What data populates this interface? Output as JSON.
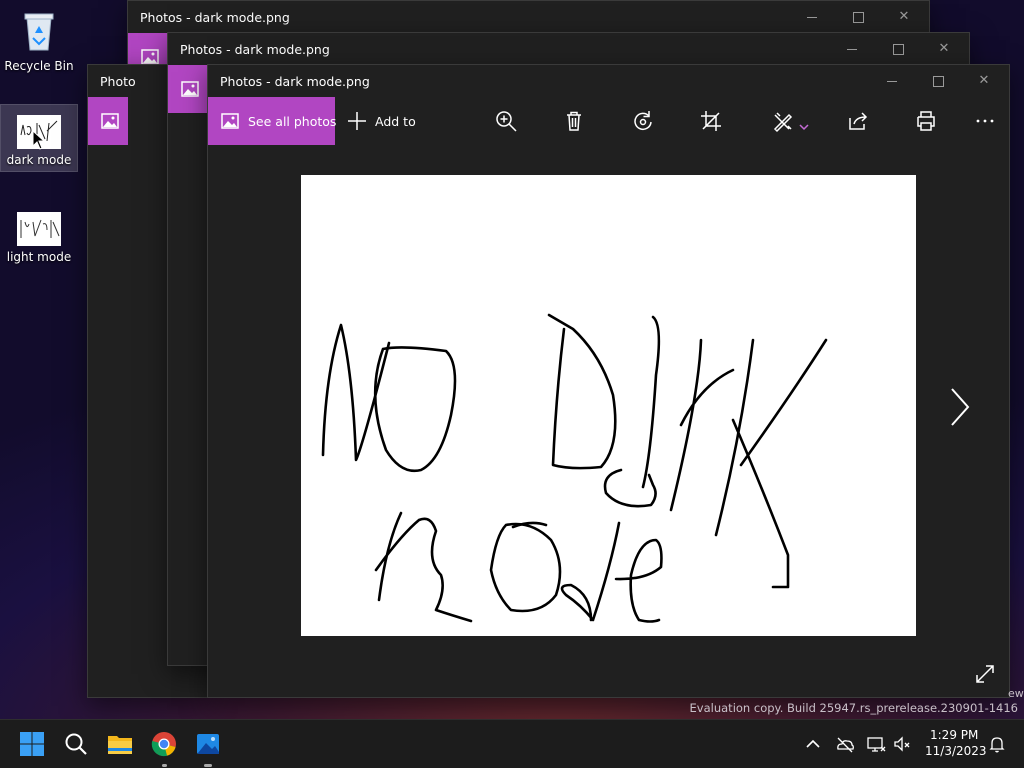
{
  "desktop": {
    "icons": [
      {
        "label": "Recycle Bin"
      },
      {
        "label": "dark mode"
      },
      {
        "label": "light mode"
      }
    ],
    "watermark_partial": "ew",
    "watermark": "Evaluation copy. Build 25947.rs_prerelease.230901-1416"
  },
  "windows": {
    "back_title": "Photos - dark mode.png",
    "middle_title": "Photos - dark mode.png",
    "partial_title": "Photo",
    "front_title": "Photos - dark mode.png"
  },
  "toolbar": {
    "see_all_label": "See all photos",
    "add_to_label": "Add to"
  },
  "taskbar": {
    "time": "1:29 PM",
    "date": "11/3/2023"
  },
  "colors": {
    "accent": "#b146c2",
    "window_bg": "#202020"
  }
}
